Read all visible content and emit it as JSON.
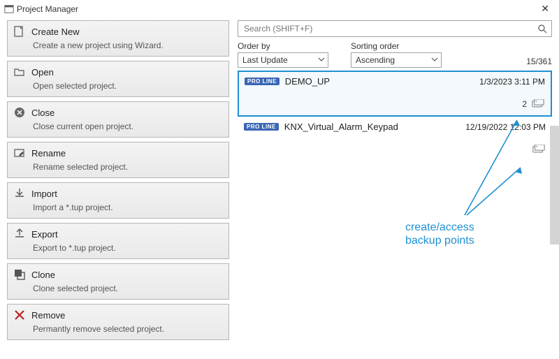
{
  "window": {
    "title": "Project Manager"
  },
  "actions": [
    {
      "id": "new",
      "title": "Create New",
      "desc": "Create a new project using Wizard."
    },
    {
      "id": "open",
      "title": "Open",
      "desc": "Open selected project."
    },
    {
      "id": "close",
      "title": "Close",
      "desc": "Close current open project."
    },
    {
      "id": "rename",
      "title": "Rename",
      "desc": "Rename selected project."
    },
    {
      "id": "import",
      "title": "Import",
      "desc": "Import a *.tup project."
    },
    {
      "id": "export",
      "title": "Export",
      "desc": "Export to *.tup project."
    },
    {
      "id": "clone",
      "title": "Clone",
      "desc": "Clone selected project."
    },
    {
      "id": "remove",
      "title": "Remove",
      "desc": "Permantly remove selected project."
    }
  ],
  "search": {
    "placeholder": "Search (SHIFT+F)"
  },
  "sort": {
    "orderby_label": "Order by",
    "orderby_value": "Last Update",
    "sorting_label": "Sorting order",
    "sorting_value": "Ascending",
    "count": "15/361"
  },
  "items": [
    {
      "badge": "PRO LINE",
      "name": "DEMO_UP",
      "time": "1/3/2023 3:11 PM",
      "backup_count": "2",
      "selected": true
    },
    {
      "badge": "PRO LINE",
      "name": "KNX_Virtual_Alarm_Keypad",
      "time": "12/19/2022 12:03 PM",
      "backup_count": "",
      "selected": false
    }
  ],
  "annotation": {
    "line1": "create/access",
    "line2": "backup points"
  }
}
